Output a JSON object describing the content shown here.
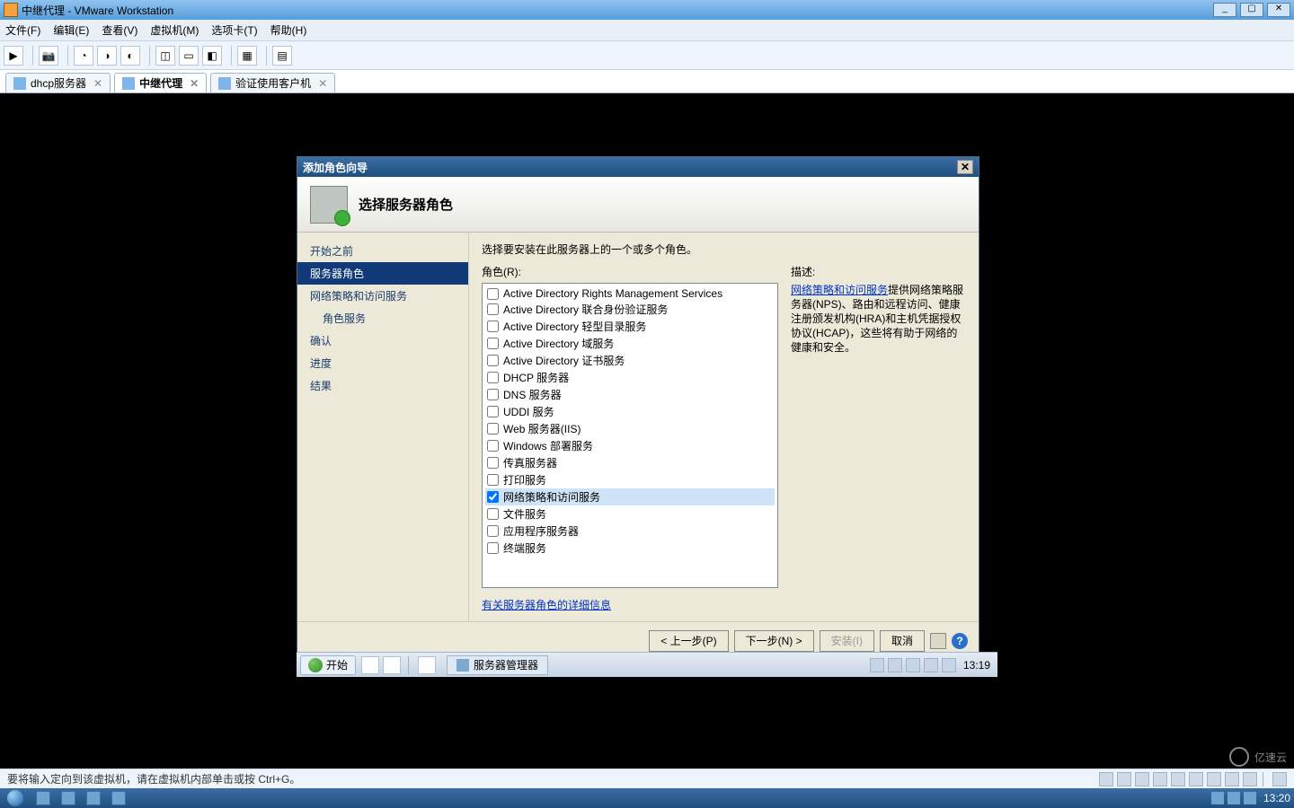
{
  "window": {
    "title": "中继代理 - VMware Workstation",
    "menus": [
      "文件(F)",
      "编辑(E)",
      "查看(V)",
      "虚拟机(M)",
      "选项卡(T)",
      "帮助(H)"
    ]
  },
  "tabs": [
    {
      "label": "dhcp服务器",
      "active": false
    },
    {
      "label": "中继代理",
      "active": true
    },
    {
      "label": "验证使用客户机",
      "active": false
    }
  ],
  "wizard": {
    "title": "添加角色向导",
    "heading": "选择服务器角色",
    "nav": [
      {
        "label": "开始之前",
        "sel": false,
        "sub": false
      },
      {
        "label": "服务器角色",
        "sel": true,
        "sub": false
      },
      {
        "label": "网络策略和访问服务",
        "sel": false,
        "sub": false
      },
      {
        "label": "角色服务",
        "sel": false,
        "sub": true
      },
      {
        "label": "确认",
        "sel": false,
        "sub": false
      },
      {
        "label": "进度",
        "sel": false,
        "sub": false
      },
      {
        "label": "结果",
        "sel": false,
        "sub": false
      }
    ],
    "intro": "选择要安装在此服务器上的一个或多个角色。",
    "roles_label": "角色(R):",
    "roles": [
      {
        "label": "Active Directory Rights Management Services",
        "checked": false
      },
      {
        "label": "Active Directory 联合身份验证服务",
        "checked": false
      },
      {
        "label": "Active Directory 轻型目录服务",
        "checked": false
      },
      {
        "label": "Active Directory 域服务",
        "checked": false
      },
      {
        "label": "Active Directory 证书服务",
        "checked": false
      },
      {
        "label": "DHCP 服务器",
        "checked": false
      },
      {
        "label": "DNS 服务器",
        "checked": false
      },
      {
        "label": "UDDI 服务",
        "checked": false
      },
      {
        "label": "Web 服务器(IIS)",
        "checked": false
      },
      {
        "label": "Windows 部署服务",
        "checked": false
      },
      {
        "label": "传真服务器",
        "checked": false
      },
      {
        "label": "打印服务",
        "checked": false
      },
      {
        "label": "网络策略和访问服务",
        "checked": true,
        "highlight": true
      },
      {
        "label": "文件服务",
        "checked": false
      },
      {
        "label": "应用程序服务器",
        "checked": false
      },
      {
        "label": "终端服务",
        "checked": false
      }
    ],
    "desc_heading": "描述:",
    "desc_link": "网络策略和访问服务",
    "desc_body": "提供网络策略服务器(NPS)、路由和远程访问、健康注册颁发机构(HRA)和主机凭据授权协议(HCAP)，这些将有助于网络的健康和安全。",
    "more_link": "有关服务器角色的详细信息",
    "buttons": {
      "prev": "< 上一步(P)",
      "next": "下一步(N) >",
      "install": "安装(I)",
      "cancel": "取消"
    }
  },
  "guest_taskbar": {
    "start": "开始",
    "task": "服务器管理器",
    "clock": "13:19"
  },
  "statusbar": {
    "hint": "要将输入定向到该虚拟机，请在虚拟机内部单击或按 Ctrl+G。"
  },
  "host_taskbar": {
    "clock": "13:20"
  },
  "watermark": "亿速云"
}
